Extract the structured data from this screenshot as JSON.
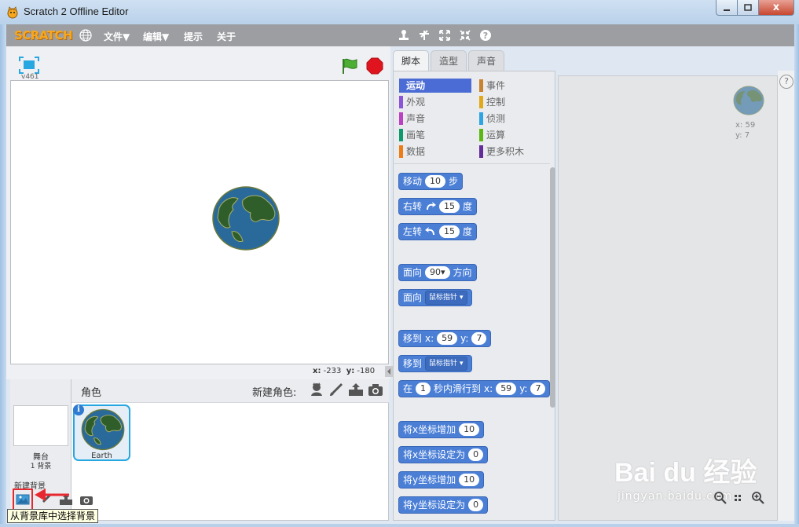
{
  "window": {
    "title": "Scratch 2 Offline Editor",
    "close": "x"
  },
  "menubar": {
    "logo": "SCRATCH",
    "items": [
      "文件▼",
      "编辑▼",
      "提示",
      "关于"
    ]
  },
  "stage": {
    "version": "v461",
    "coord_x_label": "x:",
    "coord_x": "-233",
    "coord_y_label": "y:",
    "coord_y": "-180"
  },
  "sprites": {
    "title": "角色",
    "new_sprite": "新建角色:",
    "stage_label": "舞台",
    "stage_sub": "1 背景",
    "new_backdrop": "新建背景",
    "sprite_name": "Earth",
    "info": "i",
    "tooltip": "从背景库中选择背景"
  },
  "tabs": [
    "脚本",
    "造型",
    "声音"
  ],
  "categories": [
    {
      "label": "运动",
      "color": "#4a6cd4",
      "active": true
    },
    {
      "label": "事件",
      "color": "#c88330"
    },
    {
      "label": "外观",
      "color": "#8a55d7"
    },
    {
      "label": "控制",
      "color": "#e1a91a"
    },
    {
      "label": "声音",
      "color": "#bb42c3"
    },
    {
      "label": "侦测",
      "color": "#2ca5e2"
    },
    {
      "label": "画笔",
      "color": "#0e9a6c"
    },
    {
      "label": "运算",
      "color": "#5cb712"
    },
    {
      "label": "数据",
      "color": "#ee7d16"
    },
    {
      "label": "更多积木",
      "color": "#632d99"
    }
  ],
  "blocks": {
    "move": {
      "pre": "移动",
      "val": "10",
      "post": "步"
    },
    "turn_right": {
      "pre": "右转",
      "val": "15",
      "post": "度"
    },
    "turn_left": {
      "pre": "左转",
      "val": "15",
      "post": "度"
    },
    "point_dir": {
      "pre": "面向",
      "val": "90",
      "post": "方向"
    },
    "point_towards": {
      "pre": "面向",
      "dd": "鼠标指针"
    },
    "goto_xy": {
      "pre": "移到",
      "x_label": "x:",
      "x": "59",
      "y_label": "y:",
      "y": "7"
    },
    "goto_target": {
      "pre": "移到",
      "dd": "鼠标指针"
    },
    "glide": {
      "pre": "在",
      "secs": "1",
      "mid": "秒内滑行到",
      "x_label": "x:",
      "x": "59",
      "y_label": "y:",
      "y": "7"
    },
    "change_x": {
      "pre": "将x坐标增加",
      "val": "10"
    },
    "set_x": {
      "pre": "将x坐标设定为",
      "val": "0"
    },
    "change_y": {
      "pre": "将y坐标增加",
      "val": "10"
    },
    "set_y": {
      "pre": "将y坐标设定为",
      "val": "0"
    }
  },
  "scripts_area": {
    "x_label": "x:",
    "x": "59",
    "y_label": "y:",
    "y": "7",
    "help": "?"
  },
  "watermark": {
    "brand": "Bai du 经验",
    "url": "jingyan.baidu.com"
  }
}
